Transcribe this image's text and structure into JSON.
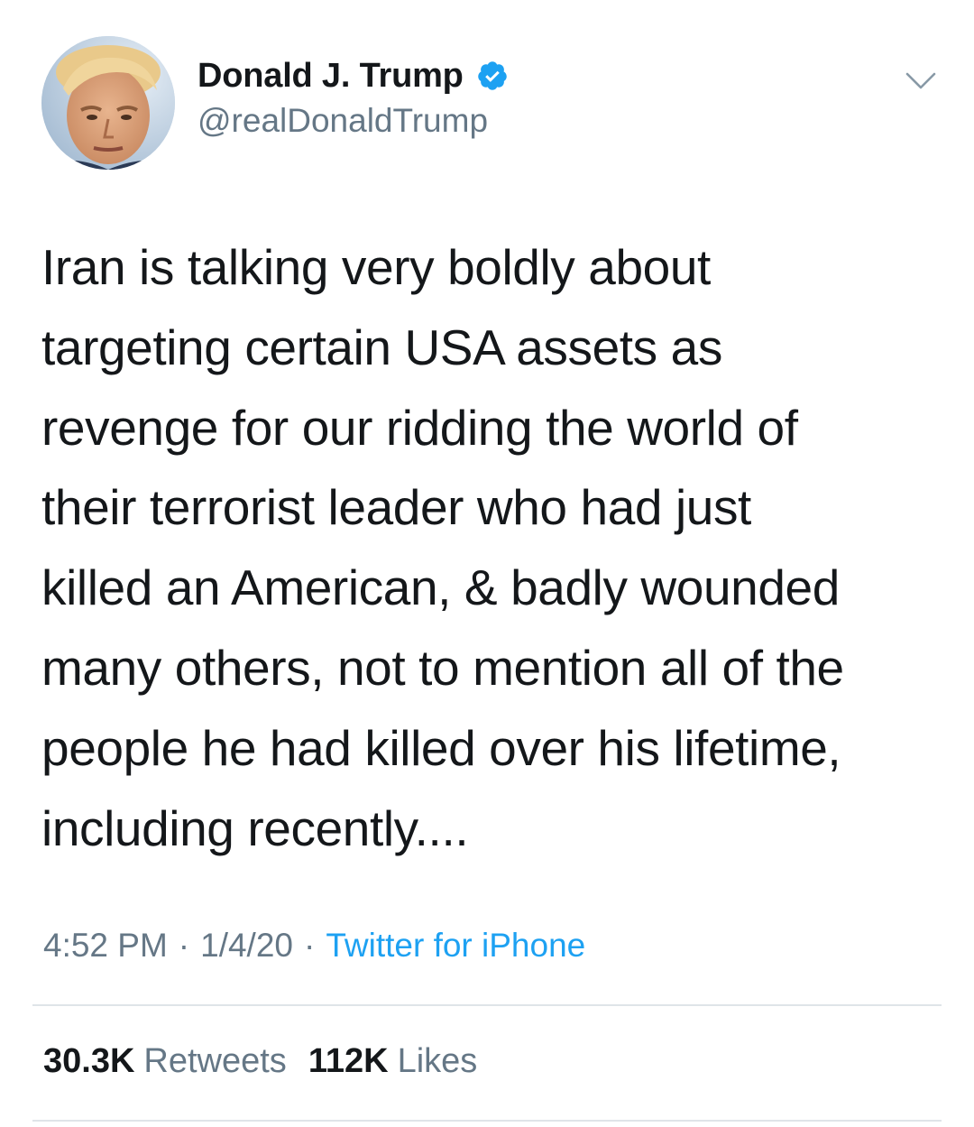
{
  "author": {
    "display_name": "Donald J. Trump",
    "handle": "@realDonaldTrump",
    "verified_icon": "verified-badge-icon",
    "avatar": "profile-photo"
  },
  "tweet": {
    "lines": [
      "Iran is talking very boldly about",
      "targeting certain USA assets as",
      "revenge for our ridding the world of",
      "their terrorist leader who had just",
      "killed an American, & badly wounded",
      "many others, not to mention all of the",
      "people he had killed over his lifetime,",
      "including recently...."
    ]
  },
  "meta": {
    "time": "4:52 PM",
    "separator": "·",
    "date": "1/4/20",
    "source": "Twitter for iPhone"
  },
  "stats": {
    "retweets_count": "30.3K",
    "retweets_label": "Retweets",
    "likes_count": "112K",
    "likes_label": "Likes"
  },
  "colors": {
    "text": "#14171a",
    "secondary": "#657786",
    "accent": "#1da1f2",
    "divider": "#dfe4e8"
  }
}
